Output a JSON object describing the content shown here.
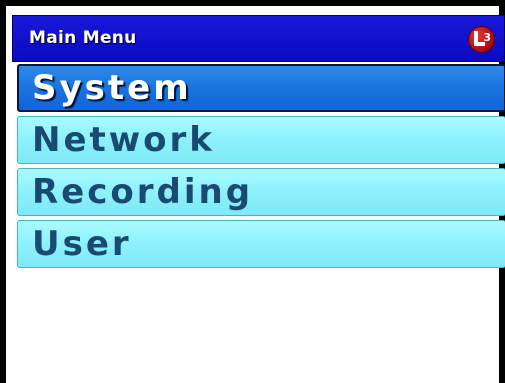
{
  "header": {
    "title": "Main Menu",
    "logo_icon": "l3-logo-icon",
    "logo_text": "L3",
    "background_color": "#0a0ac4"
  },
  "menu": {
    "selected_index": 0,
    "items": [
      {
        "label": "System"
      },
      {
        "label": "Network"
      },
      {
        "label": "Recording"
      },
      {
        "label": "User"
      }
    ],
    "item_color": "#8cf1fb",
    "selected_color": "#1a74df"
  }
}
